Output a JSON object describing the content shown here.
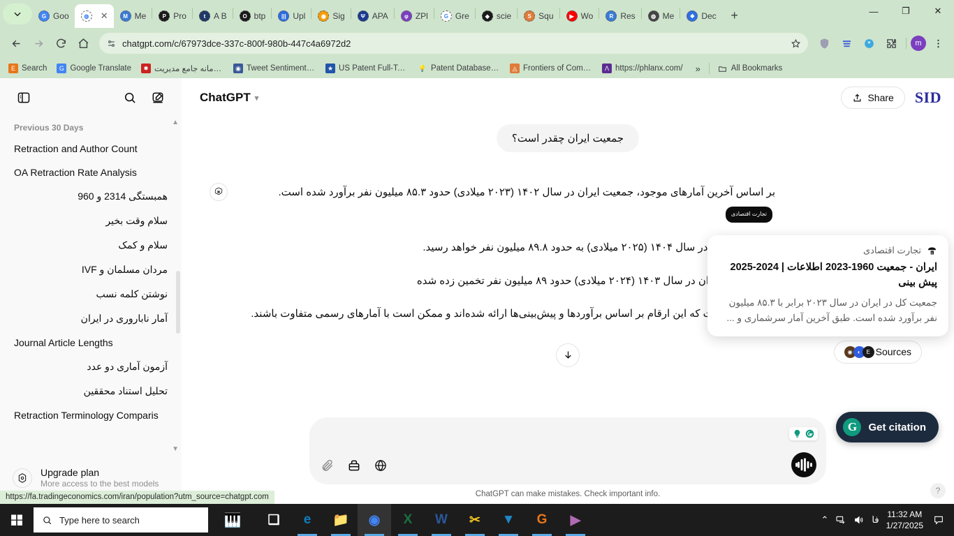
{
  "browser": {
    "tabs": [
      {
        "title": "Goo",
        "icon": "google-docs-icon",
        "color": "#4285f4",
        "glyph": "G",
        "active": false
      },
      {
        "title": "",
        "icon": "chatgpt-icon",
        "color": "#ffffff",
        "glyph": "◍",
        "active": true
      },
      {
        "title": "Me",
        "icon": "mendeley-icon",
        "color": "#3a7bd5",
        "glyph": "M",
        "active": false
      },
      {
        "title": "Pro",
        "icon": "proquest-icon",
        "color": "#1a1a1a",
        "glyph": "P",
        "active": false
      },
      {
        "title": "A B",
        "icon": "tds-icon",
        "color": "#1f3864",
        "glyph": "t",
        "active": false
      },
      {
        "title": "btp",
        "icon": "github-icon",
        "color": "#1a1a1a",
        "glyph": "O",
        "active": false
      },
      {
        "title": "Upl",
        "icon": "upload-icon",
        "color": "#2d6cdf",
        "glyph": "|||",
        "active": false
      },
      {
        "title": "Sig",
        "icon": "sign-icon",
        "color": "#f59e0b",
        "glyph": "◉",
        "active": false
      },
      {
        "title": "APA",
        "icon": "apa-icon",
        "color": "#1a3a8f",
        "glyph": "Ψ",
        "active": false
      },
      {
        "title": "ZPl",
        "icon": "zpl-icon",
        "color": "#7b3fbf",
        "glyph": "φ",
        "active": false
      },
      {
        "title": "Gre",
        "icon": "google-icon",
        "color": "#ffffff",
        "glyph": "G",
        "active": false
      },
      {
        "title": "scie",
        "icon": "science-icon",
        "color": "#1a1a1a",
        "glyph": "◆",
        "active": false
      },
      {
        "title": "Squ",
        "icon": "squarespace-icon",
        "color": "#e07b39",
        "glyph": "S",
        "active": false
      },
      {
        "title": "Wo",
        "icon": "youtube-icon",
        "color": "#ff0000",
        "glyph": "▶",
        "active": false
      },
      {
        "title": "Res",
        "icon": "researchgate-icon",
        "color": "#3a7bd5",
        "glyph": "R",
        "active": false
      },
      {
        "title": "Me",
        "icon": "globe-icon",
        "color": "#444444",
        "glyph": "◍",
        "active": false
      },
      {
        "title": "Dec",
        "icon": "dec-icon",
        "color": "#2f6fe0",
        "glyph": "❖",
        "active": false
      }
    ],
    "new_tab_label": "+",
    "window_controls": {
      "minimize": "—",
      "maximize": "❐",
      "close": "✕"
    },
    "url": "chatgpt.com/c/67973dce-337c-800f-980b-447c4a6972d2",
    "profile_initial": "m",
    "bookmarks": [
      {
        "label": "Search",
        "icon": "endnote-icon",
        "color": "#e8761a",
        "glyph": "E"
      },
      {
        "label": "Google Translate",
        "icon": "google-translate-icon",
        "color": "#4285f4",
        "glyph": "G"
      },
      {
        "label": "سامانه جامع مديريت...",
        "icon": "sama-icon",
        "color": "#cc2222",
        "glyph": "✸"
      },
      {
        "label": "Tweet Sentiment Vis...",
        "icon": "tweet-icon",
        "color": "#3b5998",
        "glyph": "◉"
      },
      {
        "label": "US Patent Full-Text...",
        "icon": "uspto-icon",
        "color": "#2255aa",
        "glyph": "★"
      },
      {
        "label": "Patent Database Se...",
        "icon": "bulb-icon",
        "color": "#f3c623",
        "glyph": "💡"
      },
      {
        "label": "Frontiers of Comput...",
        "icon": "frontiers-icon",
        "color": "#e07b39",
        "glyph": "◬"
      },
      {
        "label": "https://phlanx.com/",
        "icon": "phlanx-icon",
        "color": "#5b2d91",
        "glyph": "Λ"
      }
    ],
    "bookmarks_overflow": "»",
    "all_bookmarks_label": "All Bookmarks",
    "status_url": "https://fa.tradingeconomics.com/iran/population?utm_source=chatgpt.com"
  },
  "sidebar": {
    "section_label": "Previous 30 Days",
    "items": [
      {
        "label": "Retraction and Author Count",
        "rtl": false
      },
      {
        "label": "OA Retraction Rate Analysis",
        "rtl": false
      },
      {
        "label": "همبستگی 2314 و 960",
        "rtl": true
      },
      {
        "label": "سلام وقت بخیر",
        "rtl": true
      },
      {
        "label": "سلام و کمک",
        "rtl": true
      },
      {
        "label": "مردان مسلمان و IVF",
        "rtl": true
      },
      {
        "label": "نوشتن کلمه نسب",
        "rtl": true
      },
      {
        "label": "آمار ناباروری در ایران",
        "rtl": true
      },
      {
        "label": "Journal Article Lengths",
        "rtl": false
      },
      {
        "label": "آزمون آماری دو عدد",
        "rtl": true
      },
      {
        "label": "تحلیل استناد محققین",
        "rtl": true
      },
      {
        "label": "Retraction Terminology Comparis",
        "rtl": false
      }
    ],
    "upgrade": {
      "title": "Upgrade plan",
      "subtitle": "More access to the best models"
    }
  },
  "main": {
    "model_name": "ChatGPT",
    "share_label": "Share",
    "sid_logo": "SID",
    "user_message": "جمعیت ایران چقدر است؟",
    "assistant_paragraphs": [
      "بر اساس آخرین آمارهای موجود، جمعیت ایران در سال ۱۴۰۲ (۲۰۲۳ میلادی) حدود ۸۵.۳ میلیون نفر برآورد شده است.",
      "ه جمعیت ایران در سال ۱۴۰۴ (۲۰۲۵ میلادی) به حدود ۸۹.۸ میلیون نفر خواهد رسید.",
      "یگر، جمعیت ایران در سال ۱۴۰۳ (۲۰۲۴ میلادی) حدود ۸۹ میلیون نفر تخمین زده شده",
      "لازم به ذکر است که این ارقام بر اساس برآوردها و پیش‌بینی‌ها ارائه شده‌اند و ممکن است با آمارهای رسمی متفاوت باشند."
    ],
    "citation_pill": "تجارت اقتصادی",
    "sources_label": "Sources",
    "tooltip": {
      "source_name": "تجارت اقتصادی",
      "title": "ایران - جمعیت 1960-2023 اطلاعات | 2024-2025 پیش بینی",
      "snippet": "جمعیت کل در ایران در سال ۲۰۲۳ برابر با ۸۵.۳ میلیون نفر برآورد شده است. طبق آخرین آمار سرشماری و ..."
    },
    "composer": {
      "placeholder": "",
      "value": ""
    },
    "disclaimer": "ChatGPT can make mistakes. Check important info.",
    "get_citation_label": "Get citation",
    "help_label": "?"
  },
  "taskbar": {
    "search_placeholder": "Type here to search",
    "apps": [
      {
        "name": "task-view-icon",
        "glyph": "❑",
        "color": "#ffffff"
      },
      {
        "name": "edge-icon",
        "glyph": "e",
        "color": "#0e7ec0"
      },
      {
        "name": "file-explorer-icon",
        "glyph": "📁",
        "color": "#f7c54a"
      },
      {
        "name": "chrome-icon",
        "glyph": "◉",
        "color": "#4285f4"
      },
      {
        "name": "excel-icon",
        "glyph": "X",
        "color": "#1d6f42"
      },
      {
        "name": "word-icon",
        "glyph": "W",
        "color": "#2b579a"
      },
      {
        "name": "snipping-tool-icon",
        "glyph": "✂",
        "color": "#f3c623"
      },
      {
        "name": "vlc-icon",
        "glyph": "▼",
        "color": "#1e88c7"
      },
      {
        "name": "gpdf-icon",
        "glyph": "G",
        "color": "#e8761a"
      },
      {
        "name": "media-player-icon",
        "glyph": "▶",
        "color": "#b06ab3"
      }
    ],
    "tray": {
      "lang": "فا",
      "time": "11:32 AM",
      "date": "1/27/2025"
    }
  },
  "colors": {
    "chrome_bg": "#cfe4cc",
    "accent_dark": "#1d2b3e",
    "citation_green": "#0f9b7e",
    "sid_blue": "#2b2b9c"
  }
}
